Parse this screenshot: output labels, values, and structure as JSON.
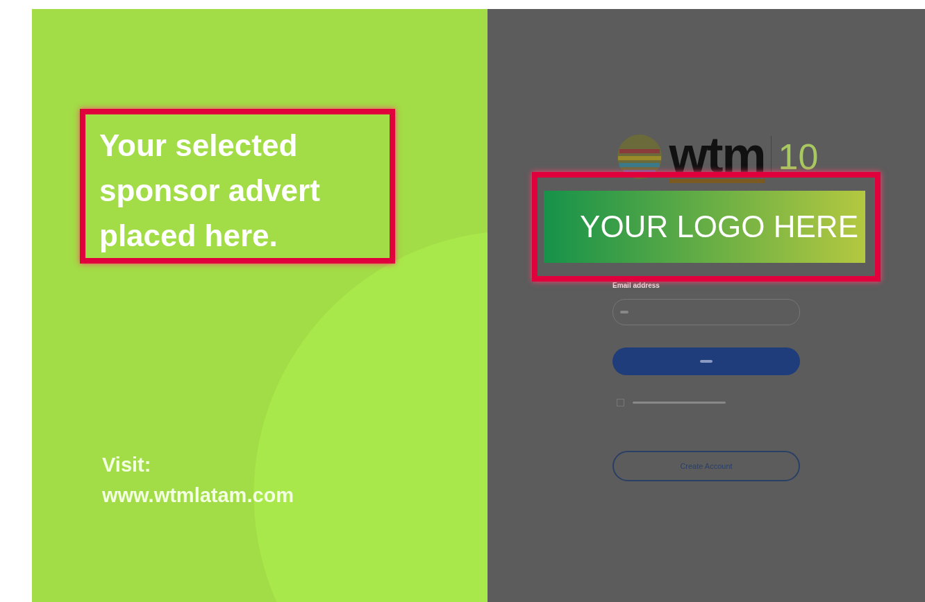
{
  "advert": {
    "headline": "Your selected sponsor advert placed here.",
    "visit_label": "Visit:",
    "url": "www.wtmlatam.com"
  },
  "login": {
    "logo": {
      "wordmark": "wtm",
      "anniversary": "10"
    },
    "logo_placeholder": "YOUR LOGO HERE",
    "email_label": "Email address",
    "remember": {
      "checked": false
    },
    "create_account": "Create Account"
  }
}
